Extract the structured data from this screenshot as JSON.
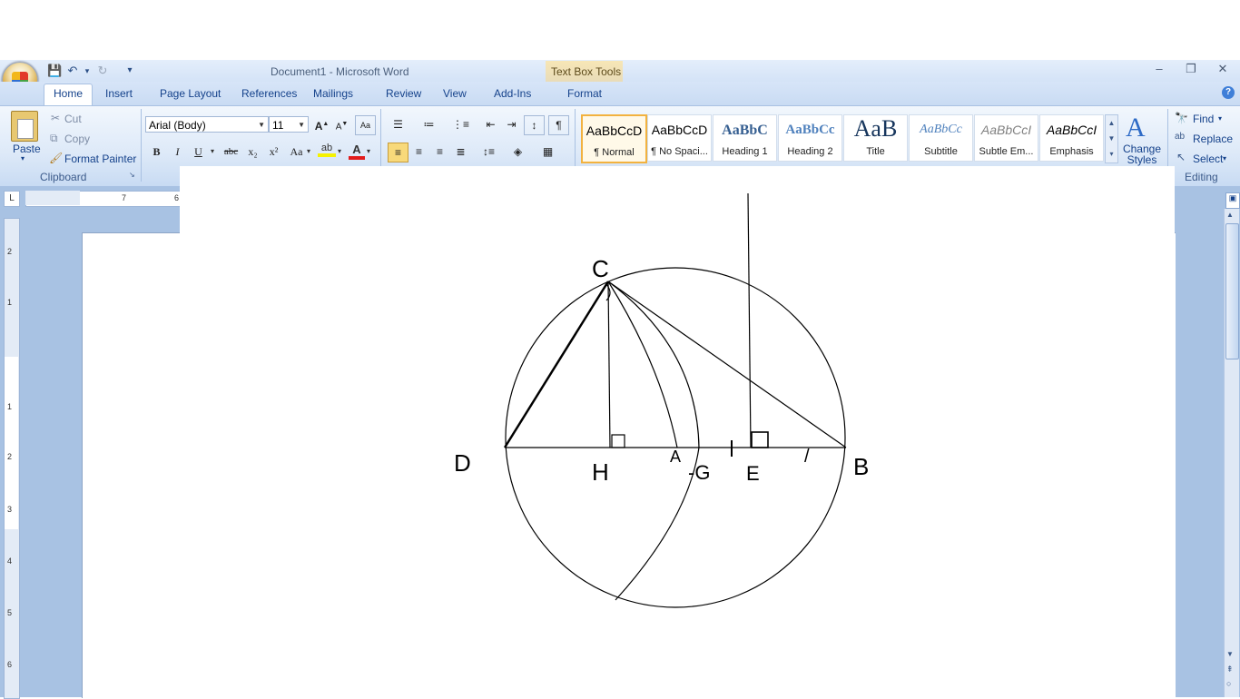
{
  "window": {
    "title": "Document1 - Microsoft Word",
    "contextual_tab_group": "Text Box Tools",
    "minimize": "–",
    "maximize": "❐",
    "close": "✕"
  },
  "qat": {
    "save": "💾",
    "undo": "↶",
    "redo": "↻",
    "customize": "▾"
  },
  "tabs": [
    "Home",
    "Insert",
    "Page Layout",
    "References",
    "Mailings",
    "Review",
    "View",
    "Add-Ins",
    "Format"
  ],
  "help": "?",
  "clipboard": {
    "group_label": "Clipboard",
    "paste": "Paste",
    "cut": "Cut",
    "copy": "Copy",
    "format_painter": "Format Painter"
  },
  "font": {
    "name": "Arial (Body)",
    "size": "11",
    "grow": "A",
    "shrink": "A",
    "bold": "B",
    "italic": "I",
    "underline": "U",
    "strike": "abc",
    "subscript": "x₂",
    "superscript": "x²",
    "change_case": "Aa",
    "font_color": "A"
  },
  "styles": [
    {
      "sample": "AaBbCcD",
      "name": "¶ Normal"
    },
    {
      "sample": "AaBbCcD",
      "name": "¶ No Spaci..."
    },
    {
      "sample": "AaBbC",
      "name": "Heading 1"
    },
    {
      "sample": "AaBbCc",
      "name": "Heading 2"
    },
    {
      "sample": "AaB",
      "name": "Title"
    },
    {
      "sample": "AaBbCc",
      "name": "Subtitle"
    },
    {
      "sample": "AaBbCcI",
      "name": "Subtle Em..."
    },
    {
      "sample": "AaBbCcI",
      "name": "Emphasis"
    }
  ],
  "change_styles": "Change Styles",
  "editing": {
    "group_label": "Editing",
    "find": "Find",
    "replace": "Replace",
    "select": "Select"
  },
  "ruler": {
    "h_numbers": [
      "7",
      "6"
    ],
    "v_numbers": [
      "2",
      "1",
      "1",
      "2",
      "3",
      "4",
      "5",
      "6"
    ]
  },
  "drawing_labels": {
    "C": "C",
    "D": "D",
    "H": "H",
    "A": "A",
    "G": "-G",
    "E": "E",
    "B": "B",
    "one": "/"
  }
}
